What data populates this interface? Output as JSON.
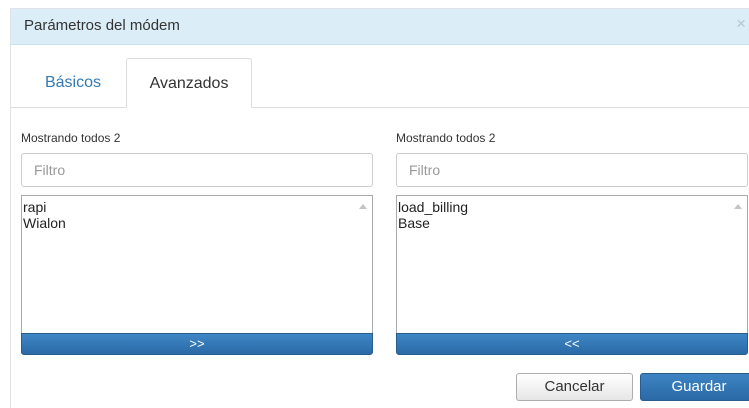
{
  "dialog": {
    "title": "Parámetros del módem",
    "close_glyph": "×",
    "close_icon": "close-icon"
  },
  "tabs": [
    {
      "label": "Básicos",
      "active": false
    },
    {
      "label": "Avanzados",
      "active": true
    }
  ],
  "left_panel": {
    "count_text": "Mostrando todos 2",
    "filter_placeholder": "Filtro",
    "filter_value": "",
    "options": [
      "rapi",
      "Wialon"
    ],
    "move_label": ">>"
  },
  "right_panel": {
    "count_text": "Mostrando todos 2",
    "filter_placeholder": "Filtro",
    "filter_value": "",
    "options": [
      "load_billing",
      "Base"
    ],
    "move_label": "<<"
  },
  "footer": {
    "cancel_label": "Cancelar",
    "save_label": "Guardar"
  },
  "colors": {
    "titlebar_bg": "#dbeef8",
    "accent": "#337ab7",
    "primary_button": "#2f76b6"
  }
}
